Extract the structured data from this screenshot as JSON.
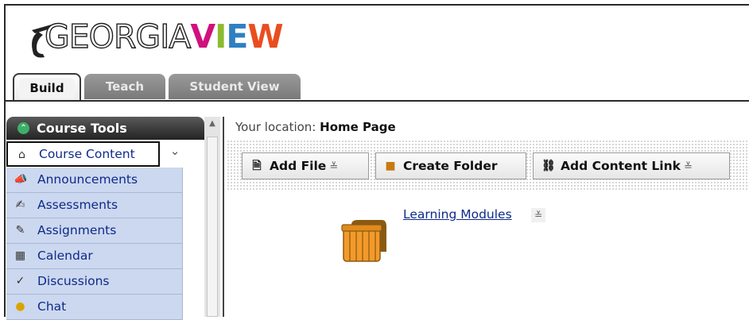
{
  "logo": {
    "text_part1": "GEORGIA",
    "text_part2": [
      "V",
      "I",
      "E",
      "W"
    ],
    "view_colors": [
      "#d0117d",
      "#8bbb2e",
      "#2f7fc3",
      "#e94d1f"
    ]
  },
  "tabs": [
    {
      "label": "Build",
      "active": true
    },
    {
      "label": "Teach",
      "active": false
    },
    {
      "label": "Student View",
      "active": false
    }
  ],
  "sidebar": {
    "header": "Course Tools",
    "header_icon": "collapse-up-icon",
    "collapse_icon": "double-chevron-down-icon",
    "items": [
      {
        "label": "Course Content",
        "icon": "home-icon",
        "active": true
      },
      {
        "label": "Announcements",
        "icon": "megaphone-icon"
      },
      {
        "label": "Assessments",
        "icon": "assessment-icon"
      },
      {
        "label": "Assignments",
        "icon": "assignment-icon"
      },
      {
        "label": "Calendar",
        "icon": "calendar-icon"
      },
      {
        "label": "Discussions",
        "icon": "pushpin-icon"
      },
      {
        "label": "Chat",
        "icon": "chat-bubble-icon"
      }
    ]
  },
  "location": {
    "prefix": "Your location:",
    "page": "Home Page"
  },
  "toolbar": {
    "add_file": "Add File",
    "create_folder": "Create Folder",
    "add_content_link": "Add Content Link"
  },
  "content": {
    "items": [
      {
        "label": "Learning Modules",
        "icon": "learning-module-icon"
      }
    ]
  },
  "colors": {
    "accent_blue": "#0e2a8a",
    "sidebar_bg": "#ccd8ef",
    "tab_inactive": "#8a8a8a"
  }
}
